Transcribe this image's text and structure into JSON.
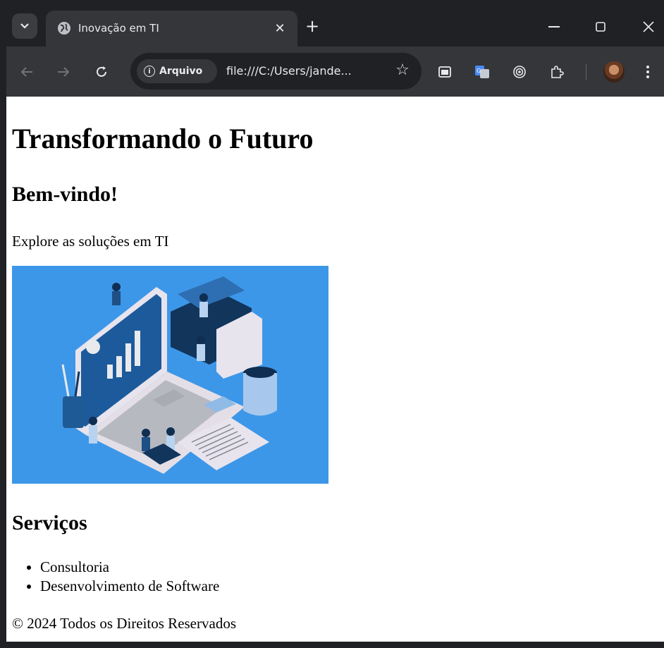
{
  "browser": {
    "tab_title": "Inovação em TI",
    "chip_label": "Arquivo",
    "url": "file:///C:/Users/jande...",
    "icons": [
      "tab-search-icon",
      "globe-icon",
      "close-icon",
      "plus-icon",
      "minimize-icon",
      "maximize-icon",
      "window-close-icon",
      "back-icon",
      "forward-icon",
      "reload-icon",
      "info-icon",
      "star-icon",
      "picture-in-picture-icon",
      "google-translate-icon",
      "cast-icon",
      "extensions-icon",
      "profile-avatar",
      "more-menu-icon"
    ]
  },
  "page": {
    "title": "Transformando o Futuro",
    "welcome_heading": "Bem-vindo!",
    "lead": "Explore as soluções em TI",
    "services_heading": "Serviços",
    "services": [
      "Consultoria",
      "Desenvolvimento de Software"
    ],
    "footer": "© 2024 Todos os Direitos Reservados"
  },
  "colors": {
    "tabbar": "#202124",
    "toolbar": "#35363a",
    "hero_bg": "#3d97e8"
  }
}
